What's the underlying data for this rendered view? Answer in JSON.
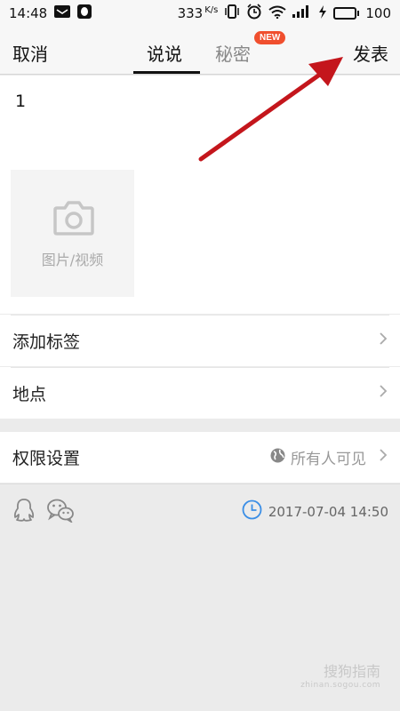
{
  "status_bar": {
    "time": "14:48",
    "speed": "333",
    "speed_unit": "K/s",
    "battery": "100",
    "battery_level": 1.0,
    "icons": [
      "mail-icon",
      "qq-notification-icon",
      "vibrate-icon",
      "alarm-icon",
      "wifi-icon",
      "signal-icon",
      "charging-icon",
      "battery-icon"
    ]
  },
  "nav": {
    "cancel_label": "取消",
    "tab_say": "说说",
    "tab_secret": "秘密",
    "new_badge": "NEW",
    "publish_label": "发表"
  },
  "compose": {
    "text": "1",
    "media_label": "图片/视频",
    "media_icon": "camera-icon"
  },
  "options": {
    "tags_label": "添加标签",
    "location_label": "地点",
    "permission_label": "权限设置",
    "permission_value": "所有人可见",
    "permission_icon": "globe-icon"
  },
  "footer": {
    "timestamp": "2017-07-04 14:50",
    "icons": [
      "qq-icon",
      "wechat-icon",
      "clock-icon"
    ]
  },
  "annotation": {
    "color": "#c4161c",
    "target": "发表"
  },
  "watermark": {
    "text": "搜狗指南",
    "subtext": "zhinan.sogou.com"
  },
  "colors": {
    "badge": "#f04f2e",
    "clock": "#3a8ee6",
    "tab_active": "#111111"
  }
}
